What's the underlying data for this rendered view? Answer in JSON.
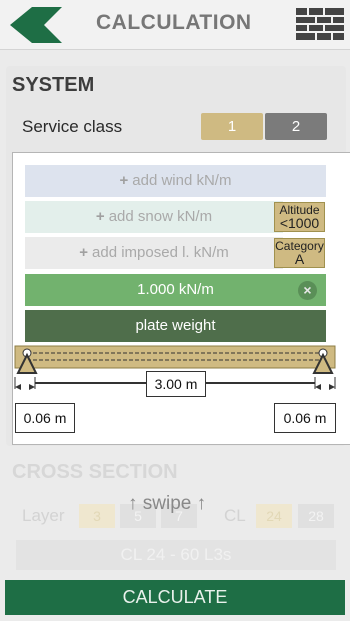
{
  "header": {
    "title": "CALCULATION",
    "back_icon": "back-arrow-icon",
    "menu_icon": "brick-wall-icon"
  },
  "system": {
    "title": "SYSTEM",
    "service_class_label": "Service class",
    "service_class_options": [
      "1",
      "2"
    ],
    "service_class_selected": "1"
  },
  "loads": {
    "wind_label": "add wind kN/m",
    "snow_label": "add snow kN/m",
    "imposed_label": "add imposed l. kN/m",
    "altitude_tag": [
      "Altitude",
      "<1000"
    ],
    "category_tag": [
      "Category",
      "A"
    ],
    "dead_load_value": "1.000 kN/m",
    "plate_weight_label": "plate weight"
  },
  "beam": {
    "span": "3.00 m",
    "left_support": "0.06 m",
    "right_support": "0.06 m"
  },
  "cross_section": {
    "title": "CROSS SECTION",
    "layer_label": "Layer",
    "layer_options": [
      "3",
      "5",
      "7"
    ],
    "cl_label": "CL",
    "cl_options": [
      "24",
      "28"
    ],
    "product": "CL 24 - 60 L3s",
    "swipe_hint": "↑ swipe ↑"
  },
  "footer": {
    "calculate_label": "CALCULATE"
  },
  "colors": {
    "primary_green": "#1e6e45",
    "accent_gold": "#cfba82",
    "load_green": "#72b26e",
    "plate_green": "#4f6e4b"
  }
}
